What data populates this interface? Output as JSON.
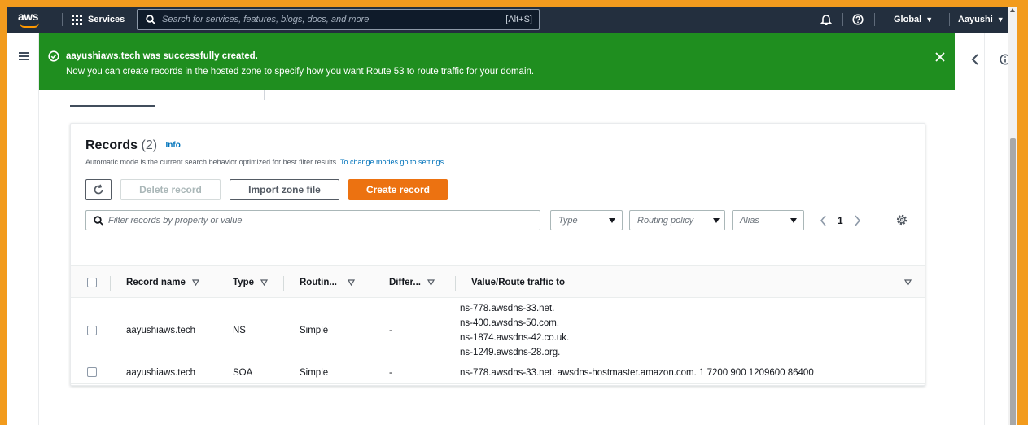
{
  "topnav": {
    "logo_text": "aws",
    "services_label": "Services",
    "search_placeholder": "Search for services, features, blogs, docs, and more",
    "search_shortcut": "[Alt+S]",
    "region_label": "Global",
    "user_label": "Aayushi"
  },
  "flash": {
    "title": "aayushiaws.tech was successfully created.",
    "body": "Now you can create records in the hosted zone to specify how you want Route 53 to route traffic for your domain."
  },
  "records": {
    "title": "Records",
    "count": "(2)",
    "info_link": "Info",
    "description": "Automatic mode is the current search behavior optimized for best filter results.",
    "description_link": "To change modes go to settings.",
    "buttons": {
      "delete": "Delete record",
      "import": "Import zone file",
      "create": "Create record"
    },
    "filter_placeholder": "Filter records by property or value",
    "type_select": "Type",
    "routing_select": "Routing policy",
    "alias_select": "Alias",
    "page_number": "1",
    "columns": [
      "Record name",
      "Type",
      "Routin...",
      "Differ...",
      "Value/Route traffic to"
    ],
    "rows": [
      {
        "name": "aayushiaws.tech",
        "type": "NS",
        "routing": "Simple",
        "differ": "-",
        "values": [
          "ns-778.awsdns-33.net.",
          "ns-400.awsdns-50.com.",
          "ns-1874.awsdns-42.co.uk.",
          "ns-1249.awsdns-28.org."
        ]
      },
      {
        "name": "aayushiaws.tech",
        "type": "SOA",
        "routing": "Simple",
        "differ": "-",
        "values": [
          "ns-778.awsdns-33.net. awsdns-hostmaster.amazon.com. 1 7200 900 1209600 86400"
        ]
      }
    ]
  },
  "colors": {
    "border": "#f29b1d",
    "nav_bg": "#232f3e",
    "success": "#1f8e1f",
    "primary_button": "#ec7211",
    "link": "#0073bb"
  },
  "icons": [
    "grid-icon",
    "search-icon",
    "bell-icon",
    "help-icon",
    "menu-icon",
    "check-circle-icon",
    "close-icon",
    "chevron-left-icon",
    "info-icon",
    "refresh-icon",
    "gear-icon",
    "sort-icon"
  ]
}
